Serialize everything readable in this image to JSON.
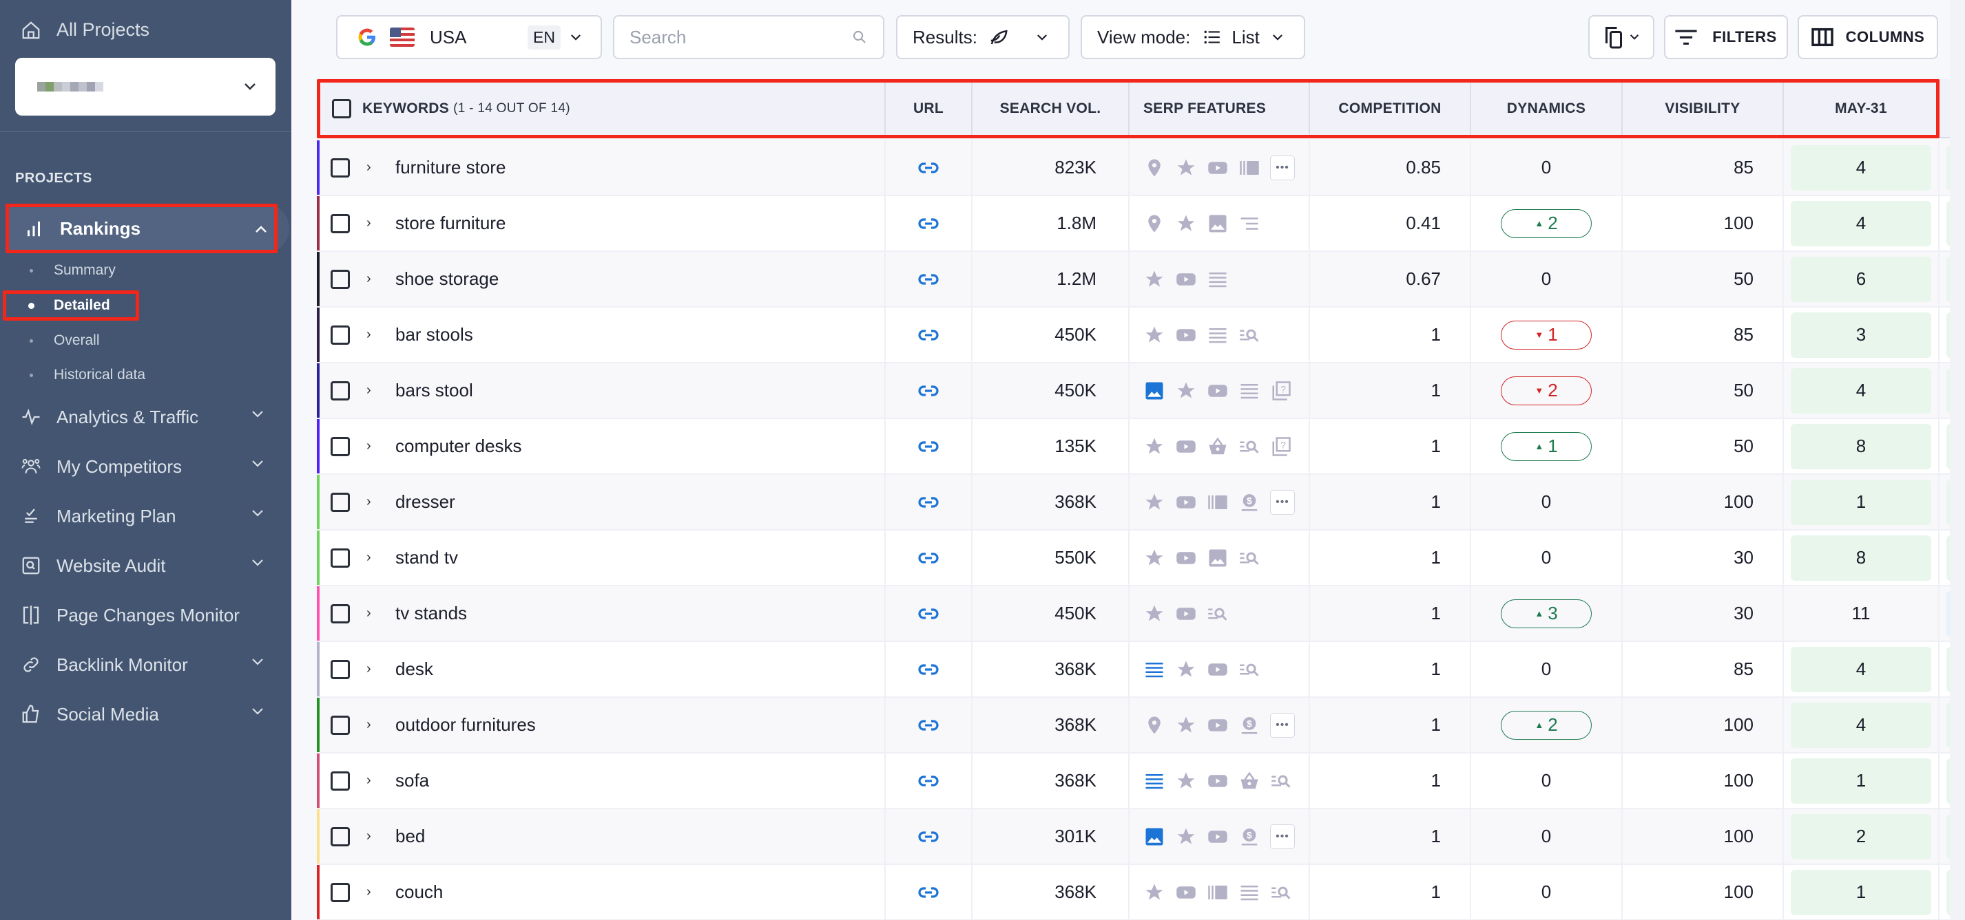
{
  "sidebar": {
    "all_projects_label": "All Projects",
    "project_name": "",
    "section_label": "PROJECTS",
    "items": [
      {
        "label": "Rankings",
        "icon": "bar-chart-icon",
        "expanded": true,
        "active": true
      },
      {
        "label": "Analytics & Traffic",
        "icon": "pulse-icon",
        "expanded": false
      },
      {
        "label": "My Competitors",
        "icon": "users-icon",
        "expanded": false
      },
      {
        "label": "Marketing Plan",
        "icon": "checklist-icon",
        "expanded": false
      },
      {
        "label": "Website Audit",
        "icon": "audit-search-icon",
        "expanded": false
      },
      {
        "label": "Page Changes Monitor",
        "icon": "page-compare-icon",
        "expanded": null
      },
      {
        "label": "Backlink Monitor",
        "icon": "link-icon",
        "expanded": false
      },
      {
        "label": "Social Media",
        "icon": "thumbs-up-icon",
        "expanded": false
      }
    ],
    "rankings_subitems": [
      {
        "label": "Summary",
        "active": false
      },
      {
        "label": "Detailed",
        "active": true
      },
      {
        "label": "Overall",
        "active": false
      },
      {
        "label": "Historical data",
        "active": false
      }
    ]
  },
  "toolbar": {
    "search_engine": "google-icon",
    "country": "USA",
    "language": "EN",
    "search_placeholder": "Search",
    "search_value": "",
    "results_label": "Results:",
    "results_icon": "leaf-icon",
    "view_mode_label": "View mode:",
    "view_mode_value": "List",
    "filters_label": "FILTERS",
    "columns_label": "COLUMNS"
  },
  "table": {
    "headers": {
      "keywords": "KEYWORDS",
      "keywords_count": "(1 - 14 OUT OF 14)",
      "url": "URL",
      "search_vol": "SEARCH VOL.",
      "serp_features": "SERP FEATURES",
      "competition": "COMPETITION",
      "dynamics": "DYNAMICS",
      "visibility": "VISIBILITY",
      "date": "MAY-31"
    },
    "rows": [
      {
        "keyword": "furniture store",
        "color": "#4a2bf0",
        "search_vol": "823K",
        "serp": [
          "pin",
          "star",
          "video",
          "carousel",
          "more"
        ],
        "competition": "0.85",
        "dynamics": {
          "value": "0",
          "dir": "none"
        },
        "visibility": "85",
        "position": "4",
        "top": true
      },
      {
        "keyword": "store furniture",
        "color": "#9a2d4a",
        "search_vol": "1.8M",
        "serp": [
          "pin",
          "star",
          "image",
          "snippet"
        ],
        "competition": "0.41",
        "dynamics": {
          "value": "2",
          "dir": "up"
        },
        "visibility": "100",
        "position": "4",
        "top": true
      },
      {
        "keyword": "shoe storage",
        "color": "#1c1c2a",
        "search_vol": "1.2M",
        "serp": [
          "star",
          "video",
          "list"
        ],
        "competition": "0.67",
        "dynamics": {
          "value": "0",
          "dir": "none"
        },
        "visibility": "50",
        "position": "6",
        "top": true
      },
      {
        "keyword": "bar stools",
        "color": "#2d2144",
        "search_vol": "450K",
        "serp": [
          "star",
          "video",
          "list",
          "related"
        ],
        "competition": "1",
        "dynamics": {
          "value": "1",
          "dir": "down"
        },
        "visibility": "85",
        "position": "3",
        "top": true
      },
      {
        "keyword": "bars stool",
        "color": "#2a229a",
        "search_vol": "450K",
        "serp": [
          "image-active",
          "star",
          "video",
          "list",
          "faq"
        ],
        "competition": "1",
        "dynamics": {
          "value": "2",
          "dir": "down"
        },
        "visibility": "50",
        "position": "4",
        "top": true
      },
      {
        "keyword": "computer desks",
        "color": "#4f24f2",
        "search_vol": "135K",
        "serp": [
          "star",
          "video",
          "shopping",
          "related",
          "faq"
        ],
        "competition": "1",
        "dynamics": {
          "value": "1",
          "dir": "up"
        },
        "visibility": "50",
        "position": "8",
        "top": true
      },
      {
        "keyword": "dresser",
        "color": "#6fd45a",
        "search_vol": "368K",
        "serp": [
          "star",
          "video",
          "carousel",
          "ads",
          "more"
        ],
        "competition": "1",
        "dynamics": {
          "value": "0",
          "dir": "none"
        },
        "visibility": "100",
        "position": "1",
        "top": true
      },
      {
        "keyword": "stand tv",
        "color": "#6fd45a",
        "search_vol": "550K",
        "serp": [
          "star",
          "video",
          "image",
          "related"
        ],
        "competition": "1",
        "dynamics": {
          "value": "0",
          "dir": "none"
        },
        "visibility": "30",
        "position": "8",
        "top": true
      },
      {
        "keyword": "tv stands",
        "color": "#ff52ad",
        "search_vol": "450K",
        "serp": [
          "star",
          "video",
          "related"
        ],
        "competition": "1",
        "dynamics": {
          "value": "3",
          "dir": "up"
        },
        "visibility": "30",
        "position": "11",
        "top": false
      },
      {
        "keyword": "desk",
        "color": "#b5b3c8",
        "search_vol": "368K",
        "serp": [
          "list-active",
          "star",
          "video",
          "related"
        ],
        "competition": "1",
        "dynamics": {
          "value": "0",
          "dir": "none"
        },
        "visibility": "85",
        "position": "4",
        "top": true
      },
      {
        "keyword": "outdoor furnitures",
        "color": "#239423",
        "search_vol": "368K",
        "serp": [
          "pin",
          "star",
          "video",
          "ads",
          "more"
        ],
        "competition": "1",
        "dynamics": {
          "value": "2",
          "dir": "up"
        },
        "visibility": "100",
        "position": "4",
        "top": true
      },
      {
        "keyword": "sofa",
        "color": "#d24f78",
        "search_vol": "368K",
        "serp": [
          "list-active",
          "star",
          "video",
          "shopping",
          "related"
        ],
        "competition": "1",
        "dynamics": {
          "value": "0",
          "dir": "none"
        },
        "visibility": "100",
        "position": "1",
        "top": true
      },
      {
        "keyword": "bed",
        "color": "#fde08e",
        "search_vol": "301K",
        "serp": [
          "image-active",
          "star",
          "video",
          "ads",
          "more"
        ],
        "competition": "1",
        "dynamics": {
          "value": "0",
          "dir": "none"
        },
        "visibility": "100",
        "position": "2",
        "top": true
      },
      {
        "keyword": "couch",
        "color": "#d92525",
        "search_vol": "368K",
        "serp": [
          "star",
          "video",
          "carousel",
          "list",
          "related"
        ],
        "competition": "1",
        "dynamics": {
          "value": "0",
          "dir": "none"
        },
        "visibility": "100",
        "position": "1",
        "top": true
      }
    ]
  },
  "colors": {
    "sidebar_bg": "#435570",
    "accent_blue": "#1b74d6",
    "serp_icon": "#b3b1c6",
    "up": "#1c7a4e",
    "down": "#d12323",
    "top_position_bg": "#e8f6ec",
    "highlight": "#f2261a"
  }
}
